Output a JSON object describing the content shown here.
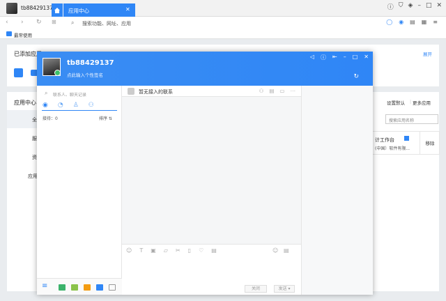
{
  "browser": {
    "user_tab": "tb88429137",
    "app_tab": "应用中心",
    "tab_close": "✕",
    "address": "搜索功能、网址、应用",
    "bookmark": "最常使用"
  },
  "page": {
    "added_apps_title": "已添加应用",
    "expand": "展开",
    "app_center_title": "应用中心",
    "side_items": [
      "全",
      "服",
      "资",
      "应用"
    ],
    "set_default": "设置默认",
    "more_apps": "更多应用",
    "search_placeholder": "搜索应用名称",
    "card_title": "计工作台",
    "card_sub": "(中国）软件有限...",
    "card_remove": "移除"
  },
  "im": {
    "username": "tb88429137",
    "signature": "点此输入个性签名",
    "search_placeholder": "联系人、聊天记录",
    "waiting": "接待：0",
    "sort": "排序 ⇅",
    "chat_title": "暂无接入的联系",
    "close_btn": "关闭",
    "send_btn": "发送 ▾"
  },
  "colors": {
    "accent": "#2f86f6"
  }
}
